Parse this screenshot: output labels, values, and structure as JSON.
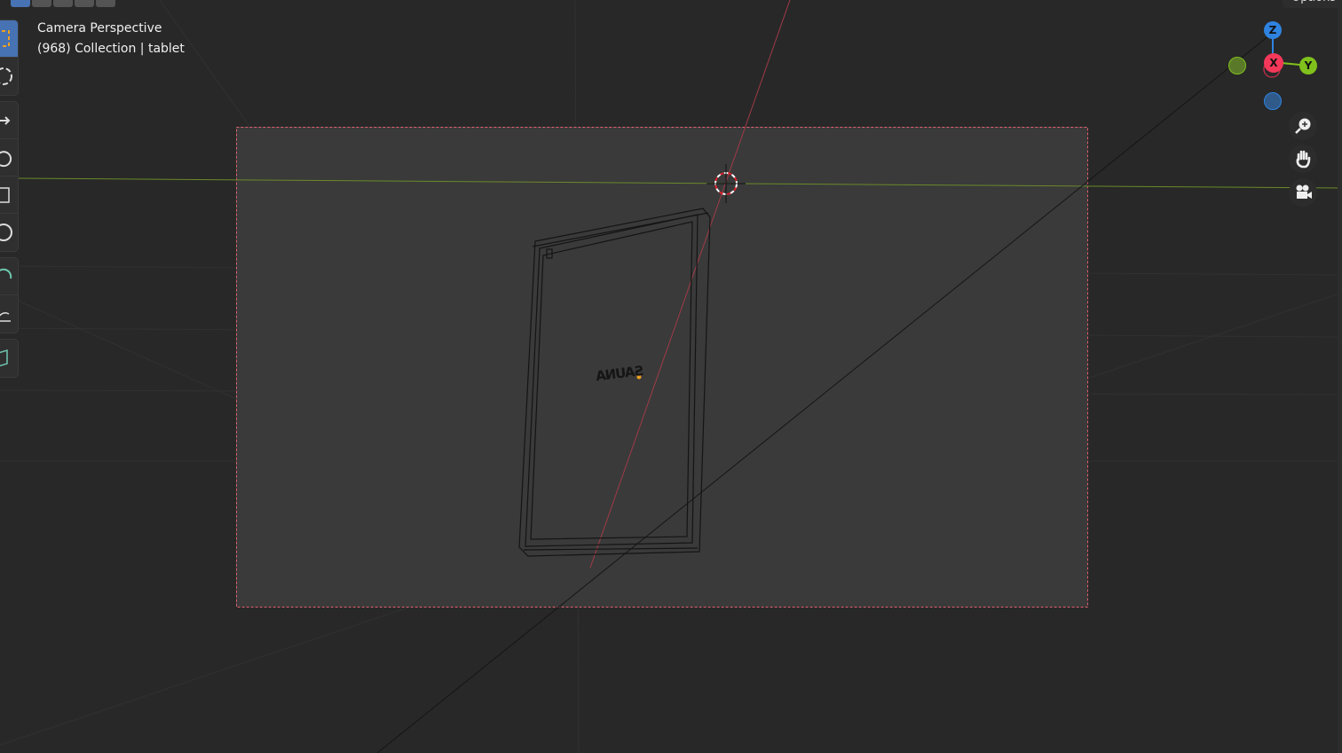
{
  "viewport": {
    "view_name": "Camera Perspective",
    "collection_info": "(968) Collection | tablet",
    "mesh_text": "SAUNA"
  },
  "header": {
    "options_label": "Options",
    "modes": [
      "new",
      "add",
      "subtract",
      "difference",
      "intersect"
    ]
  },
  "toolbar": {
    "tools": [
      "select-box",
      "cursor",
      "move",
      "rotate",
      "scale",
      "transform",
      "annotate",
      "measure",
      "add-cube"
    ]
  },
  "gizmo": {
    "axes": [
      "Z",
      "X",
      "Y"
    ],
    "colors": {
      "x": "#f5385a",
      "y": "#80c11c",
      "z": "#2f83e0"
    }
  },
  "nav_buttons": [
    "zoom",
    "pan",
    "camera-view"
  ],
  "colors": {
    "accent": "#4772b3",
    "camera_frame": "#e05060",
    "y_axis_line": "#6a8a2a",
    "x_axis_line": "#a03a48"
  }
}
